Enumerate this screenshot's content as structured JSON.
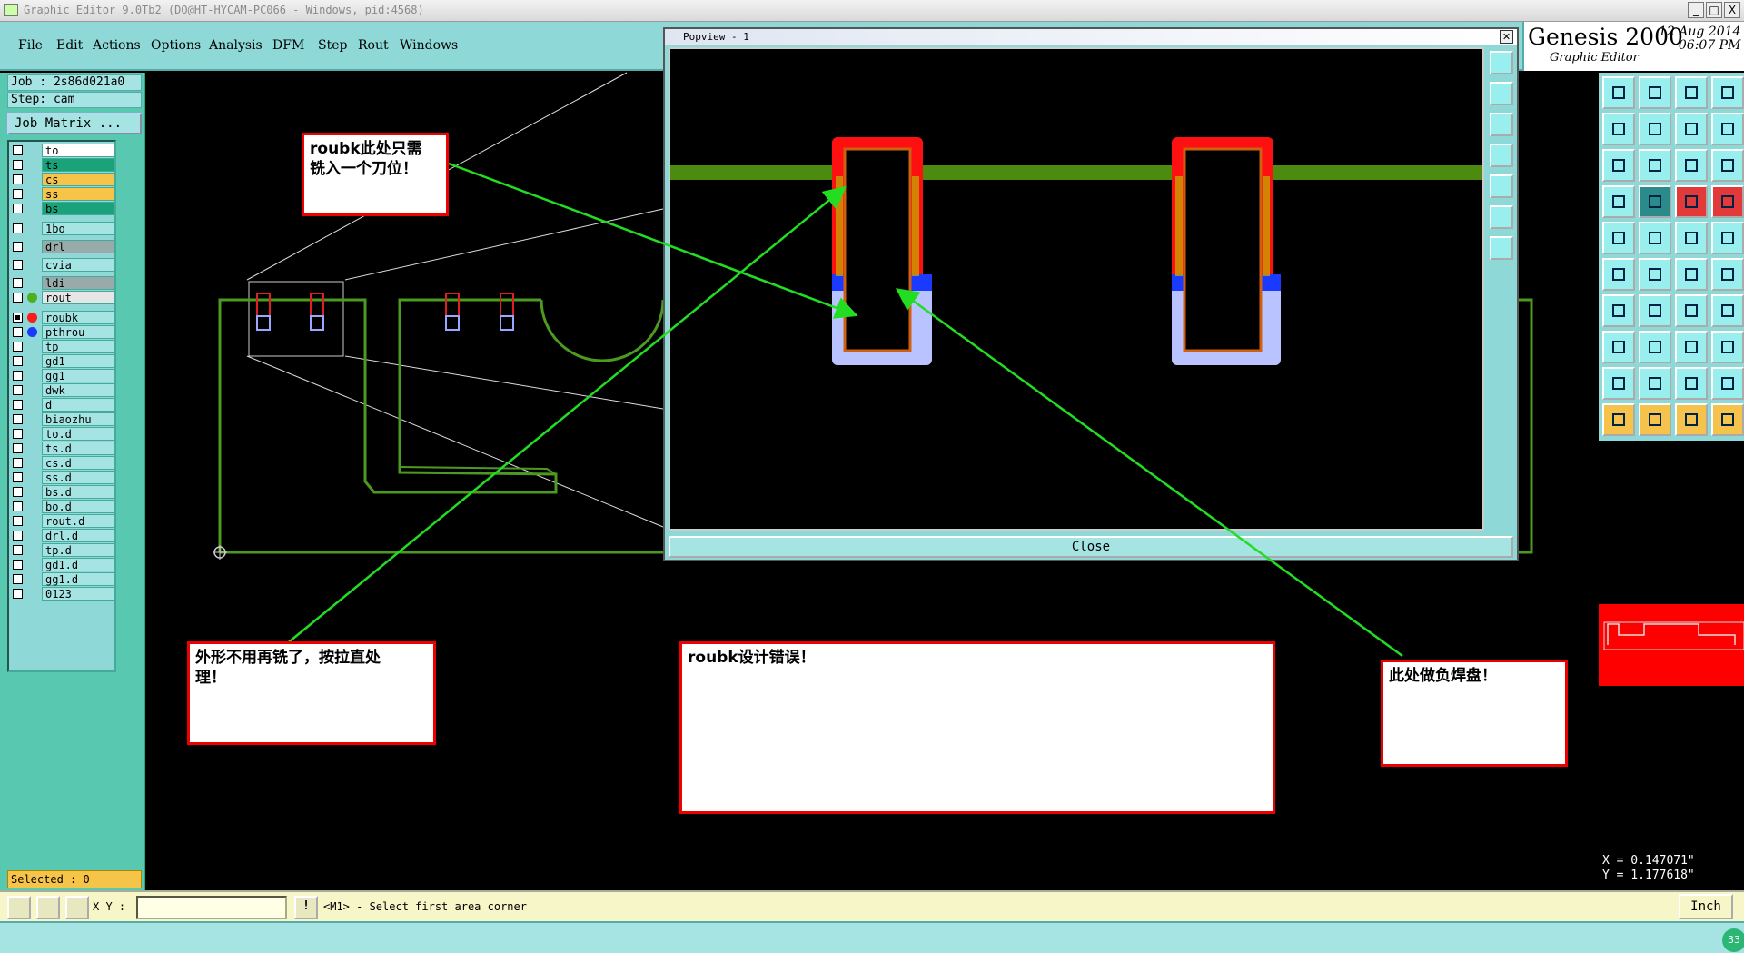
{
  "window": {
    "title": "Graphic Editor 9.0Tb2 (DO@HT-HYCAM-PC066 - Windows, pid:4568)",
    "minimize": "_",
    "restore": "□",
    "close": "X"
  },
  "menu": {
    "items": [
      "File",
      "Edit",
      "Actions",
      "Options",
      "Analysis",
      "DFM",
      "Step",
      "Rout",
      "Windows"
    ]
  },
  "brand": {
    "name": "Genesis 2000",
    "date_line1": "12 Aug 2014",
    "date_line2": "06:07 PM",
    "subtitle": "Graphic Editor"
  },
  "job": {
    "job_label": "Job : 2s86d021a0",
    "step_label": "Step: cam",
    "matrix_button": "Job Matrix ..."
  },
  "layers": [
    {
      "name": "to",
      "color": "#ffffff"
    },
    {
      "name": "ts",
      "color": "#1aa37a"
    },
    {
      "name": "cs",
      "color": "#f7c44a"
    },
    {
      "name": "ss",
      "color": "#f7c44a"
    },
    {
      "name": "bs",
      "color": "#1aa37a"
    },
    {
      "name": "1bo",
      "color": "#a6e3e3"
    },
    {
      "name": "drl",
      "color": "#9aa"
    },
    {
      "name": "cvia",
      "color": "#a6e3e3"
    },
    {
      "name": "ldi",
      "color": "#9aa"
    },
    {
      "name": "rout",
      "color": "#e6e6e6",
      "dot": "#4caf20"
    },
    {
      "name": "roubk",
      "color": "#a6e3e3",
      "dot": "#ff1a1a",
      "selected": true
    },
    {
      "name": "pthrou",
      "color": "#a6e3e3",
      "dot": "#1a3aff"
    },
    {
      "name": "tp",
      "color": "#a6e3e3"
    },
    {
      "name": "gd1",
      "color": "#a6e3e3"
    },
    {
      "name": "gg1",
      "color": "#a6e3e3"
    },
    {
      "name": "dwk",
      "color": "#a6e3e3"
    },
    {
      "name": "d",
      "color": "#a6e3e3"
    },
    {
      "name": "biaozhu",
      "color": "#a6e3e3"
    },
    {
      "name": "to.d",
      "color": "#a6e3e3"
    },
    {
      "name": "ts.d",
      "color": "#a6e3e3"
    },
    {
      "name": "cs.d",
      "color": "#a6e3e3"
    },
    {
      "name": "ss.d",
      "color": "#a6e3e3"
    },
    {
      "name": "bs.d",
      "color": "#a6e3e3"
    },
    {
      "name": "bo.d",
      "color": "#a6e3e3"
    },
    {
      "name": "rout.d",
      "color": "#a6e3e3"
    },
    {
      "name": "drl.d",
      "color": "#a6e3e3"
    },
    {
      "name": "tp.d",
      "color": "#a6e3e3"
    },
    {
      "name": "gd1.d",
      "color": "#a6e3e3"
    },
    {
      "name": "gg1.d",
      "color": "#a6e3e3"
    },
    {
      "name": "0123",
      "color": "#a6e3e3"
    }
  ],
  "selected_count": "Selected : 0",
  "popview": {
    "title": "Popview - 1",
    "close_button": "Close"
  },
  "notes": {
    "note1": "roubk此处只需\n铣入一个刀位！",
    "note2": "外形不用再铣了，按拉直处\n理！",
    "note3": "roubk设计错误！",
    "note4": "此处做负焊盘！"
  },
  "command": {
    "xy_label": "X Y :",
    "xy_value": "",
    "exclaim": "!",
    "prompt": "<M1> - Select first area corner",
    "units": "Inch",
    "page_badge": "33"
  },
  "coords": {
    "x": "X = 0.147071\"",
    "y": "Y = 1.177618\""
  },
  "colors": {
    "panel": "#8ed8d8",
    "rout_green": "#4caf20",
    "roubk_red": "#ff1a1a",
    "pthrou_blue": "#1a3aff",
    "note_border": "#e00000"
  }
}
